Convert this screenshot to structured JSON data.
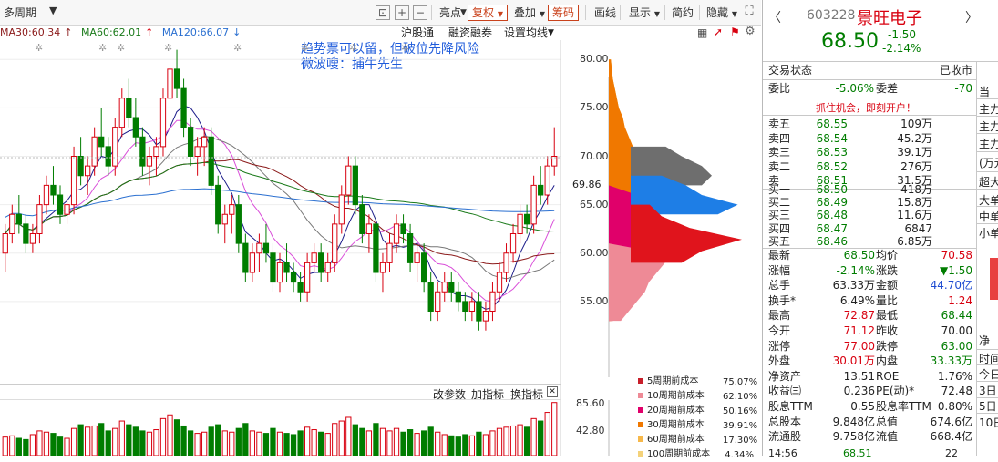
{
  "toolbar": {
    "period": "多周期",
    "highlight": "亮点",
    "fuquan": "复权",
    "overlay": "叠加",
    "chips": "筹码",
    "drawline": "画线",
    "display": "显示",
    "simple": "简约",
    "hide": "隐藏"
  },
  "ma": {
    "ma30": "MA30:60.34",
    "ma60": "MA60:62.01",
    "ma120": "MA120:66.07"
  },
  "ma_colors": {
    "ma30": "#8b1a1a",
    "ma60": "#1a7a1a",
    "ma120": "#2a6fd0"
  },
  "links": {
    "hgt": "沪股通",
    "rzrq": "融资融券",
    "setma": "设置均线"
  },
  "annotation": {
    "line1": "趋势票可以留，但破位先降风险",
    "line2": "微波嗖：捕牛先生"
  },
  "sub_toolbar": {
    "params": "改参数",
    "add": "加指标",
    "switch": "换指标"
  },
  "chip_axis": [
    "80.00",
    "75.00",
    "70.00",
    "65.00",
    "60.00",
    "55.00"
  ],
  "current_price_tag": "69.86",
  "vol_axis": [
    "85.60",
    "42.80"
  ],
  "cost_legend": [
    {
      "label": "5周期前成本",
      "pct": "75.07%",
      "color": "#c81e2a"
    },
    {
      "label": "10周期前成本",
      "pct": "62.10%",
      "color": "#ee8a96"
    },
    {
      "label": "20周期前成本",
      "pct": "50.16%",
      "color": "#e0006a"
    },
    {
      "label": "30周期前成本",
      "pct": "39.91%",
      "color": "#f07800"
    },
    {
      "label": "60周期前成本",
      "pct": "17.30%",
      "color": "#f7b84a"
    },
    {
      "label": "100周期前成本",
      "pct": "4.34%",
      "color": "#f4d27a"
    }
  ],
  "stock": {
    "code": "603228",
    "name": "景旺电子",
    "price": "68.50",
    "change": "-1.50",
    "change_pct": "-2.14%",
    "status_label": "交易状态",
    "status_value": "已收市",
    "weibi_label": "委比",
    "weibi": "-5.06%",
    "weicha_label": "委差",
    "weicha": "-70",
    "promo": "抓住机会，即刻开户！"
  },
  "sell_orders": [
    {
      "label": "卖五",
      "price": "68.55",
      "vol": "109万"
    },
    {
      "label": "卖四",
      "price": "68.54",
      "vol": "45.2万"
    },
    {
      "label": "卖三",
      "price": "68.53",
      "vol": "39.1万"
    },
    {
      "label": "卖二",
      "price": "68.52",
      "vol": "276万"
    },
    {
      "label": "卖一",
      "price": "68.51",
      "vol": "31.5万"
    }
  ],
  "buy_orders": [
    {
      "label": "买一",
      "price": "68.50",
      "vol": "418万"
    },
    {
      "label": "买二",
      "price": "68.49",
      "vol": "15.8万"
    },
    {
      "label": "买三",
      "price": "68.48",
      "vol": "11.6万"
    },
    {
      "label": "买四",
      "price": "68.47",
      "vol": "6847"
    },
    {
      "label": "买五",
      "price": "68.46",
      "vol": "6.85万"
    }
  ],
  "quote": [
    {
      "l1": "最新",
      "v1": "68.50",
      "c1": "green",
      "l2": "均价",
      "v2": "70.58",
      "c2": "red"
    },
    {
      "l1": "涨幅",
      "v1": "-2.14%",
      "c1": "green",
      "l2": "涨跌",
      "v2": "▼1.50",
      "c2": "green"
    },
    {
      "l1": "总手",
      "v1": "63.33万",
      "c1": "dark",
      "l2": "金额",
      "v2": "44.70亿",
      "c2": "blue"
    },
    {
      "l1": "换手*",
      "v1": "6.49%",
      "c1": "dark",
      "l2": "量比",
      "v2": "1.24",
      "c2": "red"
    },
    {
      "l1": "最高",
      "v1": "72.87",
      "c1": "red",
      "l2": "最低",
      "v2": "68.44",
      "c2": "green"
    },
    {
      "l1": "今开",
      "v1": "71.12",
      "c1": "red",
      "l2": "昨收",
      "v2": "70.00",
      "c2": "dark"
    },
    {
      "l1": "涨停",
      "v1": "77.00",
      "c1": "red",
      "l2": "跌停",
      "v2": "63.00",
      "c2": "green"
    },
    {
      "l1": "外盘",
      "v1": "30.01万",
      "c1": "red",
      "l2": "内盘",
      "v2": "33.33万",
      "c2": "green"
    },
    {
      "l1": "净资产",
      "v1": "13.51",
      "c1": "dark",
      "l2": "ROE",
      "v2": "1.76%",
      "c2": "dark"
    },
    {
      "l1": "收益㈢",
      "v1": "0.236",
      "c1": "dark",
      "l2": "PE(动)*",
      "v2": "72.48",
      "c2": "dark"
    },
    {
      "l1": "股息TTM",
      "v1": "0.55",
      "c1": "dark",
      "l2": "股息率TTM",
      "v2": "0.80%",
      "c2": "dark"
    },
    {
      "l1": "总股本",
      "v1": "9.848亿",
      "c1": "dark",
      "l2": "总值",
      "v2": "674.6亿",
      "c2": "dark"
    },
    {
      "l1": "流通股",
      "v1": "9.758亿",
      "c1": "dark",
      "l2": "流值",
      "v2": "668.4亿",
      "c2": "dark"
    }
  ],
  "side_labels": [
    "当",
    "主力",
    "主力",
    "主力",
    "(万元",
    "超大",
    "大单",
    "中单",
    "小单",
    "净",
    "时间",
    "今日",
    "3日",
    "5日",
    "10日"
  ],
  "bottom_row": {
    "time": "14:56",
    "price": "68.51",
    "vol": "22"
  },
  "chart_data": {
    "type": "candlestick",
    "ylim": [
      50,
      82
    ],
    "candles": [
      [
        60,
        63,
        58,
        62
      ],
      [
        62,
        65,
        61,
        64
      ],
      [
        64,
        66,
        62,
        63
      ],
      [
        63,
        64,
        60,
        61
      ],
      [
        61,
        63,
        60,
        62
      ],
      [
        62,
        66,
        61,
        65
      ],
      [
        65,
        68,
        64,
        67
      ],
      [
        67,
        69,
        65,
        66
      ],
      [
        66,
        67,
        63,
        64
      ],
      [
        64,
        66,
        63,
        65
      ],
      [
        65,
        71,
        64,
        70
      ],
      [
        70,
        72,
        67,
        68
      ],
      [
        68,
        70,
        66,
        69
      ],
      [
        69,
        73,
        68,
        72
      ],
      [
        72,
        75,
        70,
        71
      ],
      [
        71,
        72,
        68,
        69
      ],
      [
        69,
        74,
        68,
        73
      ],
      [
        73,
        77,
        72,
        76
      ],
      [
        76,
        78,
        73,
        74
      ],
      [
        74,
        76,
        71,
        72
      ],
      [
        72,
        73,
        68,
        69
      ],
      [
        69,
        71,
        67,
        70
      ],
      [
        70,
        72,
        68,
        71
      ],
      [
        71,
        77,
        70,
        76
      ],
      [
        76,
        80,
        75,
        79
      ],
      [
        79,
        81,
        76,
        77
      ],
      [
        77,
        78,
        72,
        73
      ],
      [
        73,
        74,
        69,
        70
      ],
      [
        70,
        72,
        68,
        71
      ],
      [
        71,
        73,
        69,
        72
      ],
      [
        72,
        73,
        66,
        67
      ],
      [
        67,
        68,
        62,
        63
      ],
      [
        63,
        65,
        61,
        64
      ],
      [
        64,
        66,
        62,
        65
      ],
      [
        65,
        66,
        60,
        61
      ],
      [
        61,
        62,
        57,
        58
      ],
      [
        58,
        61,
        57,
        60
      ],
      [
        60,
        62,
        58,
        61
      ],
      [
        61,
        63,
        59,
        60
      ],
      [
        60,
        61,
        56,
        57
      ],
      [
        57,
        60,
        56,
        59
      ],
      [
        59,
        61,
        57,
        58
      ],
      [
        58,
        59,
        56,
        57
      ],
      [
        57,
        58,
        55,
        56
      ],
      [
        56,
        60,
        55,
        59
      ],
      [
        59,
        61,
        58,
        60
      ],
      [
        60,
        61,
        57,
        58
      ],
      [
        58,
        60,
        57,
        59
      ],
      [
        59,
        64,
        58,
        63
      ],
      [
        63,
        67,
        62,
        66
      ],
      [
        66,
        70,
        65,
        69
      ],
      [
        69,
        70,
        64,
        65
      ],
      [
        65,
        66,
        61,
        62
      ],
      [
        62,
        64,
        60,
        63
      ],
      [
        63,
        64,
        57,
        58
      ],
      [
        58,
        60,
        56,
        59
      ],
      [
        59,
        62,
        58,
        61
      ],
      [
        61,
        64,
        60,
        63
      ],
      [
        63,
        64,
        61,
        62
      ],
      [
        62,
        63,
        58,
        59
      ],
      [
        59,
        61,
        57,
        60
      ],
      [
        60,
        61,
        56,
        57
      ],
      [
        57,
        58,
        53,
        54
      ],
      [
        54,
        57,
        53,
        56
      ],
      [
        56,
        58,
        55,
        57
      ],
      [
        57,
        58,
        55,
        56
      ],
      [
        56,
        57,
        54,
        55
      ],
      [
        55,
        56,
        53,
        54
      ],
      [
        54,
        56,
        53,
        55
      ],
      [
        55,
        56,
        52,
        53
      ],
      [
        53,
        55,
        52,
        54
      ],
      [
        54,
        57,
        53,
        56
      ],
      [
        56,
        59,
        55,
        58
      ],
      [
        58,
        61,
        57,
        60
      ],
      [
        60,
        63,
        59,
        62
      ],
      [
        62,
        65,
        61,
        64
      ],
      [
        64,
        65,
        62,
        63
      ],
      [
        63,
        68,
        62,
        67
      ],
      [
        67,
        69,
        65,
        66
      ],
      [
        66,
        70,
        65,
        69
      ],
      [
        69,
        73,
        68,
        70
      ]
    ],
    "chip_profile": {
      "prices": [
        80,
        78,
        76,
        75,
        74,
        73,
        72,
        71,
        70,
        69,
        68,
        67,
        66,
        65,
        64,
        63,
        62,
        61,
        60,
        59,
        58,
        57,
        56,
        55,
        54,
        53
      ],
      "layers": [
        {
          "name": "100周期前成本",
          "color": "#f4d27a",
          "values": [
            1,
            2,
            4,
            5,
            6,
            7,
            8,
            9,
            12,
            14,
            14,
            12,
            11,
            10,
            9,
            8,
            8,
            7,
            7,
            6,
            6,
            5,
            4,
            3,
            2,
            1
          ]
        },
        {
          "name": "60周期前成本",
          "color": "#f7b84a",
          "values": [
            1,
            2,
            4,
            5,
            7,
            8,
            10,
            12,
            15,
            17,
            17,
            14,
            13,
            12,
            11,
            10,
            10,
            9,
            9,
            8,
            7,
            6,
            5,
            4,
            3,
            1
          ]
        },
        {
          "name": "30周期前成本",
          "color": "#f07800",
          "values": [
            1,
            2,
            4,
            5,
            7,
            8,
            10,
            12,
            15,
            17,
            17,
            14,
            13,
            14,
            18,
            20,
            20,
            16,
            12,
            10,
            8,
            7,
            6,
            5,
            4,
            2
          ]
        },
        {
          "name": "20周期前成本",
          "color": "#e0006a",
          "values": [
            0,
            0,
            0,
            0,
            0,
            0,
            0,
            0,
            0,
            0,
            0,
            0,
            14,
            20,
            20,
            30,
            32,
            26,
            20,
            16,
            18,
            16,
            12,
            8,
            4,
            2
          ]
        },
        {
          "name": "10周期前成本",
          "color": "#ee8a96",
          "values": [
            0,
            0,
            0,
            0,
            0,
            0,
            0,
            0,
            0,
            0,
            0,
            0,
            0,
            0,
            0,
            0,
            0,
            0,
            26,
            28,
            24,
            20,
            18,
            14,
            10,
            6
          ]
        }
      ],
      "gray_band": {
        "price_top": 71,
        "price_bottom": 67,
        "values": [
          22,
          30,
          40,
          45,
          40
        ]
      },
      "blue_band": {
        "price_top": 68,
        "price_bottom": 64,
        "values": [
          20,
          32,
          40,
          58,
          48
        ]
      },
      "red_band": {
        "price_top": 65,
        "price_bottom": 59,
        "values": [
          14,
          20,
          34,
          60,
          40,
          30
        ]
      }
    },
    "volume": [
      30,
      32,
      28,
      26,
      34,
      40,
      38,
      36,
      30,
      28,
      44,
      50,
      46,
      48,
      52,
      40,
      44,
      56,
      50,
      46,
      40,
      38,
      42,
      60,
      66,
      58,
      48,
      40,
      36,
      38,
      46,
      50,
      40,
      38,
      44,
      52,
      40,
      38,
      36,
      44,
      38,
      36,
      34,
      40,
      46,
      42,
      38,
      36,
      52,
      56,
      62,
      50,
      44,
      40,
      52,
      44,
      40,
      44,
      38,
      42,
      36,
      40,
      46,
      38,
      34,
      32,
      30,
      34,
      32,
      38,
      34,
      40,
      44,
      46,
      48,
      50,
      46,
      60,
      56,
      70,
      86
    ]
  }
}
